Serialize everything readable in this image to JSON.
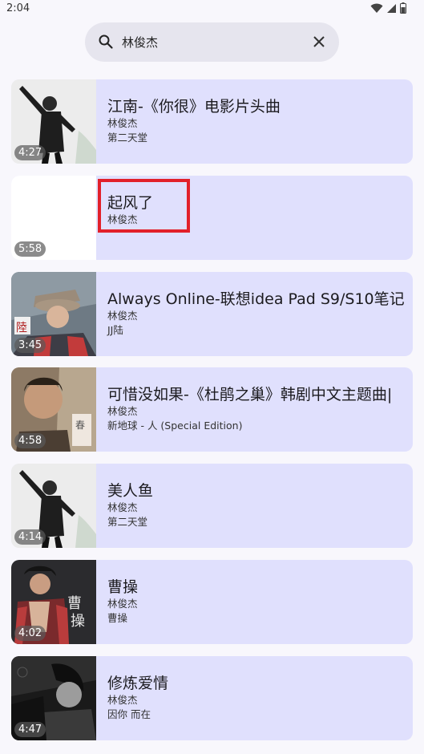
{
  "status": {
    "time": "2:04"
  },
  "search": {
    "query": "林俊杰"
  },
  "results": [
    {
      "title": "江南-《你很》电影片头曲",
      "artist": "林俊杰",
      "album": "第二天堂",
      "duration": "4:27"
    },
    {
      "title": "起风了",
      "artist": "林俊杰",
      "album": "",
      "duration": "5:58"
    },
    {
      "title": "Always Online-联想idea Pad S9/S10笔记",
      "artist": "林俊杰",
      "album": "JJ陆",
      "duration": "3:45"
    },
    {
      "title": "可惜没如果-《杜鹃之巢》韩剧中文主题曲|",
      "artist": "林俊杰",
      "album": "新地球 - 人 (Special Edition)",
      "duration": "4:58"
    },
    {
      "title": "美人鱼",
      "artist": "林俊杰",
      "album": "第二天堂",
      "duration": "4:14"
    },
    {
      "title": "曹操",
      "artist": "林俊杰",
      "album": "曹操",
      "duration": "4:02"
    },
    {
      "title": "修炼爱情",
      "artist": "林俊杰",
      "album": "因你 而在",
      "duration": "4:47"
    }
  ],
  "colors": {
    "card": "#e0e0fd",
    "highlight": "#e2202a",
    "search_bg": "#e6e5ee"
  },
  "icons": {
    "search": "search-icon",
    "clear": "close-icon",
    "wifi": "wifi-icon",
    "signal": "signal-icon",
    "battery": "battery-icon"
  }
}
